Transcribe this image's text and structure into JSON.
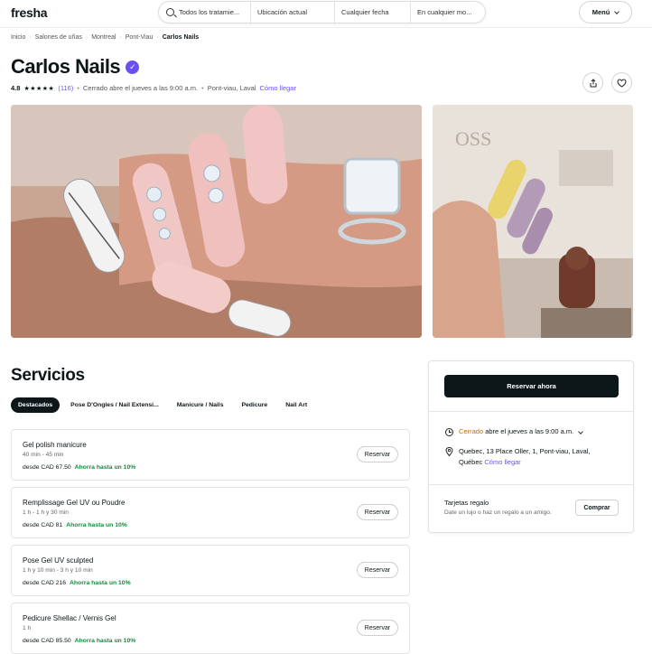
{
  "header": {
    "logo": "fresha",
    "search": {
      "treatment": "Todos los tratamie...",
      "location": "Ubicación actual",
      "date": "Cualquier fecha",
      "time": "En cualquier mo..."
    },
    "menu_label": "Menú"
  },
  "breadcrumb": [
    "Inicio",
    "Salones de uñas",
    "Montreal",
    "Pont-Viau",
    "Carlos Nails"
  ],
  "business": {
    "name": "Carlos Nails",
    "rating": "4.8",
    "stars": "★★★★★",
    "reviews": "(116)",
    "status": "Cerrado abre el jueves a las 9:00 a.m.",
    "location": "Pont-viau, Laval",
    "directions": "Cómo llegar"
  },
  "services_heading": "Servicios",
  "tabs": [
    "Destacados",
    "Pose D'Ongles / Nail Extensi...",
    "Manicure / Nails",
    "Pedicure",
    "Nail Art"
  ],
  "services": [
    {
      "name": "Gel polish manicure",
      "duration": "40 min - 45 min",
      "price": "desde CAD 67.50",
      "savings": "Ahorra hasta un 10%",
      "button": "Reservar"
    },
    {
      "name": "Remplissage Gel UV ou Poudre",
      "duration": "1 h - 1 h y 30 min",
      "price": "desde CAD 81",
      "savings": "Ahorra hasta un 10%",
      "button": "Reservar"
    },
    {
      "name": "Pose Gel UV sculpted",
      "duration": "1 h y 10 min - 3 h y 10 min",
      "price": "desde CAD 216",
      "savings": "Ahorra hasta un 10%",
      "button": "Reservar"
    },
    {
      "name": "Pedicure Shellac / Vernis Gel",
      "duration": "1 h",
      "price": "desde CAD 85.50",
      "savings": "Ahorra hasta un 10%",
      "button": "Reservar"
    }
  ],
  "booking": {
    "book_button": "Reservar ahora",
    "hours_status": "Cerrado",
    "hours_detail": "abre el jueves a las 9:00 a.m.",
    "address": "Quebec, 13 Place Oller, 1, Pont-viau, Laval,",
    "address2": "Québec",
    "directions": "Cómo llegar",
    "gift_title": "Tarjetas regalo",
    "gift_subtitle": "Date un lujo o haz un regalo a un amigo.",
    "buy_button": "Comprar"
  },
  "colors": {
    "accent": "#6950f3",
    "dark": "#0d1619",
    "savings": "#118a3e",
    "closed": "#c76d00"
  }
}
